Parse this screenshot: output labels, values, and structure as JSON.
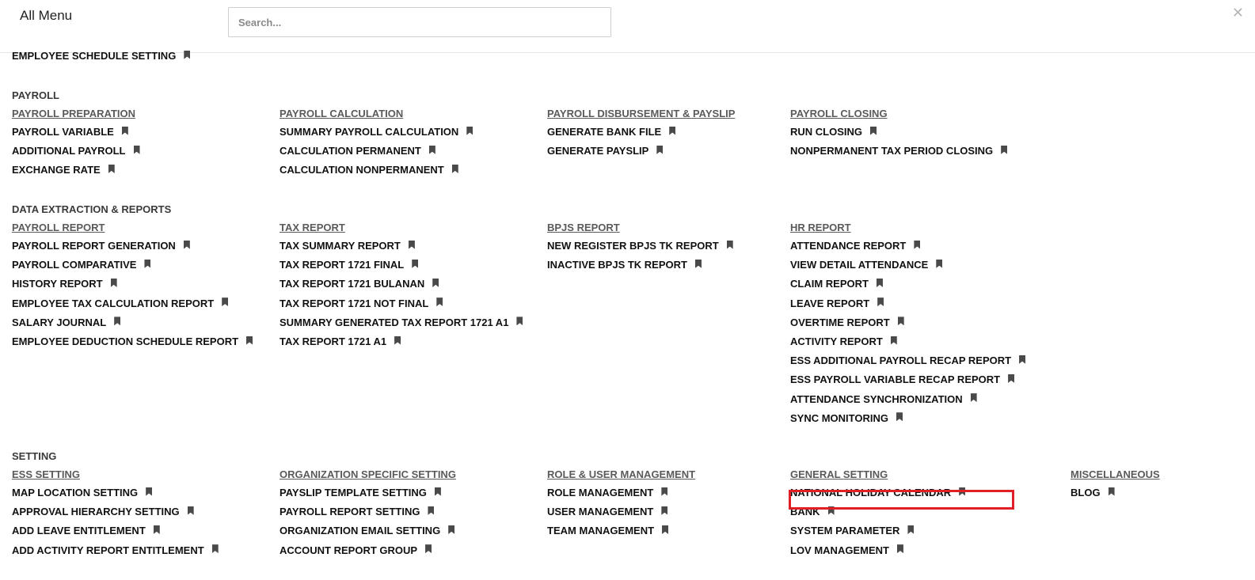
{
  "header": {
    "title": "All Menu",
    "search_placeholder": "Search...",
    "close_symbol": "✕"
  },
  "top_item": {
    "label": "EMPLOYEE SCHEDULE SETTING"
  },
  "colors": {
    "highlight_border": "#e01f26",
    "bookmark": "#4a4a4a",
    "group_heading": "#5a5a5a"
  },
  "sections": [
    {
      "title": "PAYROLL",
      "groups": [
        {
          "heading": "PAYROLL PREPARATION",
          "items": [
            "PAYROLL VARIABLE",
            "ADDITIONAL PAYROLL",
            "EXCHANGE RATE"
          ]
        },
        {
          "heading": "PAYROLL CALCULATION",
          "items": [
            "SUMMARY PAYROLL CALCULATION",
            "CALCULATION PERMANENT",
            "CALCULATION NONPERMANENT"
          ]
        },
        {
          "heading": "PAYROLL DISBURSEMENT & PAYSLIP",
          "items": [
            "GENERATE BANK FILE",
            "GENERATE PAYSLIP"
          ]
        },
        {
          "heading": "PAYROLL CLOSING",
          "items": [
            "RUN CLOSING",
            "NONPERMANENT TAX PERIOD CLOSING"
          ]
        }
      ]
    },
    {
      "title": "DATA EXTRACTION & REPORTS",
      "groups": [
        {
          "heading": "PAYROLL REPORT",
          "items": [
            "PAYROLL REPORT GENERATION",
            "PAYROLL COMPARATIVE",
            "HISTORY REPORT",
            "EMPLOYEE TAX CALCULATION REPORT",
            "SALARY JOURNAL",
            "EMPLOYEE DEDUCTION SCHEDULE REPORT"
          ]
        },
        {
          "heading": "TAX REPORT",
          "items": [
            "TAX SUMMARY REPORT",
            "TAX REPORT 1721 FINAL",
            "TAX REPORT 1721 BULANAN",
            "TAX REPORT 1721 NOT FINAL",
            "SUMMARY GENERATED TAX REPORT 1721 A1",
            "TAX REPORT 1721 A1"
          ]
        },
        {
          "heading": "BPJS REPORT",
          "items": [
            "NEW REGISTER BPJS TK REPORT",
            "INACTIVE BPJS TK REPORT"
          ]
        },
        {
          "heading": "HR REPORT",
          "items": [
            "ATTENDANCE REPORT",
            "VIEW DETAIL ATTENDANCE",
            "CLAIM REPORT",
            "LEAVE REPORT",
            "OVERTIME REPORT",
            "ACTIVITY REPORT",
            "ESS ADDITIONAL PAYROLL RECAP REPORT",
            "ESS PAYROLL VARIABLE RECAP REPORT",
            "ATTENDANCE SYNCHRONIZATION",
            "SYNC MONITORING"
          ]
        }
      ]
    },
    {
      "title": "SETTING",
      "groups": [
        {
          "heading": "ESS SETTING",
          "items": [
            "MAP LOCATION SETTING",
            "APPROVAL HIERARCHY SETTING",
            "ADD LEAVE ENTITLEMENT",
            "ADD ACTIVITY REPORT ENTITLEMENT"
          ]
        },
        {
          "heading": "ORGANIZATION SPECIFIC SETTING",
          "items": [
            "PAYSLIP TEMPLATE SETTING",
            "PAYROLL REPORT SETTING",
            "ORGANIZATION EMAIL SETTING",
            "ACCOUNT REPORT GROUP"
          ]
        },
        {
          "heading": "ROLE & USER MANAGEMENT",
          "items": [
            "ROLE MANAGEMENT",
            "USER MANAGEMENT",
            "TEAM MANAGEMENT"
          ]
        },
        {
          "heading": "GENERAL SETTING",
          "items": [
            "NATIONAL HOLIDAY CALENDAR",
            "BANK",
            "SYSTEM PARAMETER",
            "LOV MANAGEMENT"
          ]
        },
        {
          "heading": "MISCELLANEOUS",
          "items": [
            "BLOG"
          ]
        }
      ]
    }
  ],
  "highlighted_item": "NATIONAL HOLIDAY CALENDAR"
}
